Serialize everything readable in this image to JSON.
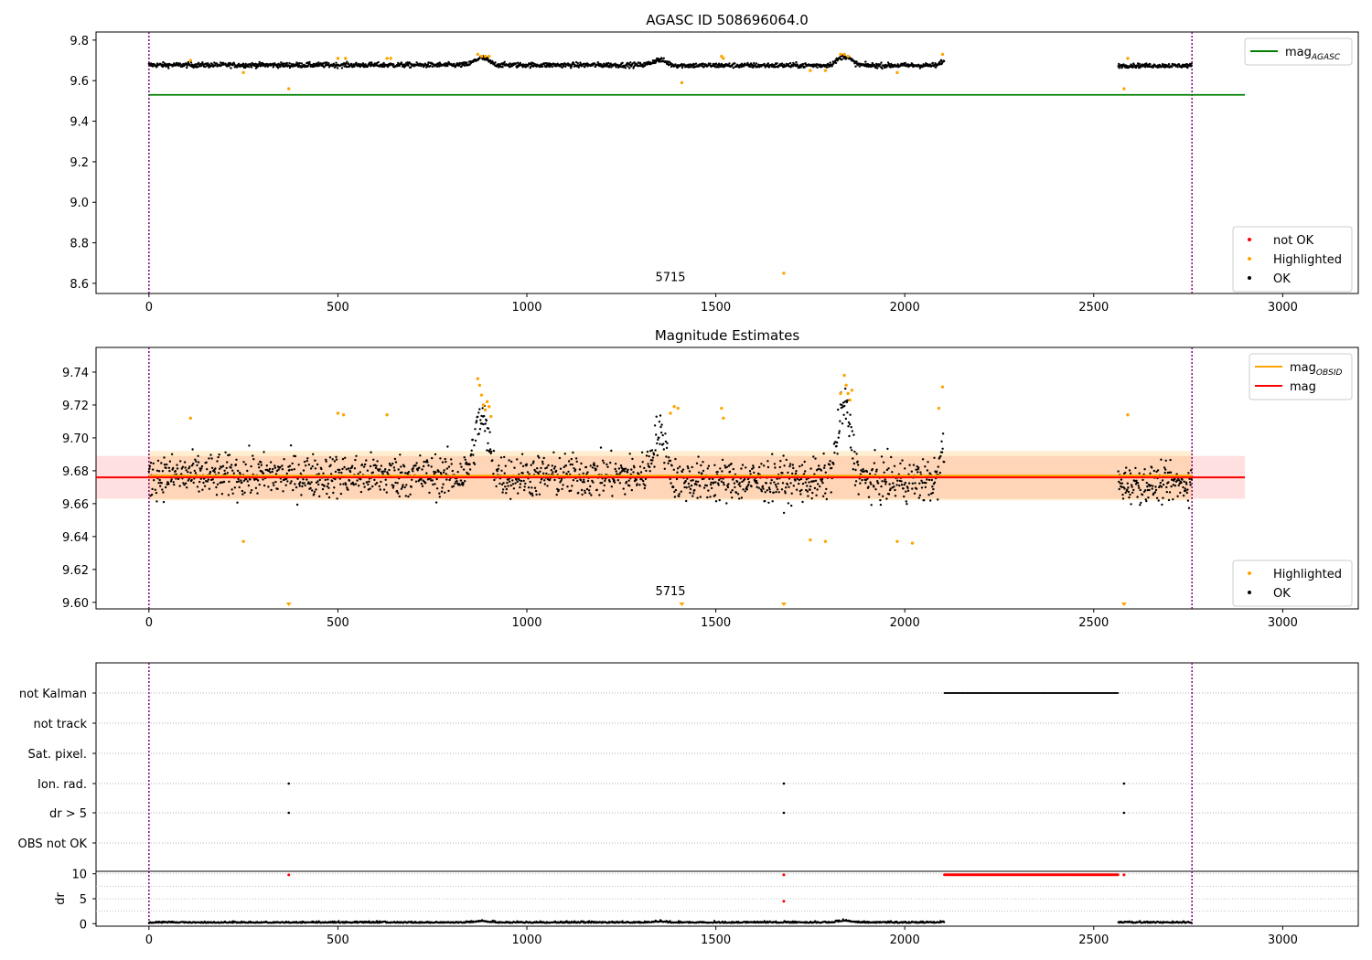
{
  "chart_data": [
    {
      "type": "scatter",
      "title": "AGASC ID 508696064.0",
      "xlabel": "",
      "ylabel": "",
      "xlim": [
        -140,
        3200
      ],
      "ylim": [
        8.55,
        9.84
      ],
      "x_ticks": [
        0,
        500,
        1000,
        1500,
        2000,
        2500,
        3000
      ],
      "y_ticks": [
        8.6,
        8.8,
        9.0,
        9.2,
        9.4,
        9.6,
        9.8
      ],
      "y_tick_labels": [
        "8.6",
        "8.8",
        "9.0",
        "9.2",
        "9.4",
        "9.6",
        "9.8"
      ],
      "vlines": [
        0,
        2760
      ],
      "obsid_label": {
        "text": "5715",
        "x": 1380,
        "y": 8.61
      },
      "mag_agasc": {
        "value": 9.53,
        "x_range": [
          0,
          2900
        ],
        "color": "#008000"
      },
      "segments": [
        {
          "x_range": [
            0,
            1380
          ],
          "base": 9.677,
          "spread": 0.012
        },
        {
          "x_range": [
            1380,
            2105
          ],
          "base": 9.675,
          "spread": 0.012
        },
        {
          "x_range": [
            2565,
            2760
          ],
          "base": 9.674,
          "spread": 0.01
        }
      ],
      "bumps": [
        {
          "center": 880,
          "width": 25,
          "height": 0.035
        },
        {
          "center": 1350,
          "width": 25,
          "height": 0.025
        },
        {
          "center": 1840,
          "width": 25,
          "height": 0.045
        },
        {
          "center": 2100,
          "width": 8,
          "height": 0.02
        }
      ],
      "highlighted_points": [
        [
          110,
          9.7
        ],
        [
          250,
          9.64
        ],
        [
          370,
          9.56
        ],
        [
          500,
          9.71
        ],
        [
          520,
          9.71
        ],
        [
          630,
          9.71
        ],
        [
          640,
          9.71
        ],
        [
          870,
          9.73
        ],
        [
          880,
          9.72
        ],
        [
          890,
          9.72
        ],
        [
          900,
          9.72
        ],
        [
          1410,
          9.59
        ],
        [
          1515,
          9.72
        ],
        [
          1520,
          9.71
        ],
        [
          1680,
          8.65
        ],
        [
          1750,
          9.65
        ],
        [
          1790,
          9.65
        ],
        [
          1830,
          9.73
        ],
        [
          1840,
          9.73
        ],
        [
          1850,
          9.72
        ],
        [
          1980,
          9.64
        ],
        [
          2100,
          9.73
        ],
        [
          2580,
          9.56
        ],
        [
          2590,
          9.71
        ]
      ],
      "legend_top": [
        {
          "label": "mag",
          "sub": "AGASC",
          "color": "#008000"
        }
      ],
      "legend_bottom": [
        {
          "label": "not OK",
          "color": "#ff0000"
        },
        {
          "label": "Highlighted",
          "color": "#ffa500"
        },
        {
          "label": "OK",
          "color": "#000000"
        }
      ]
    },
    {
      "type": "scatter",
      "title": "Magnitude Estimates",
      "xlabel": "",
      "ylabel": "",
      "xlim": [
        -140,
        3200
      ],
      "ylim": [
        9.596,
        9.755
      ],
      "x_ticks": [
        0,
        500,
        1000,
        1500,
        2000,
        2500,
        3000
      ],
      "y_ticks": [
        9.6,
        9.62,
        9.64,
        9.66,
        9.68,
        9.7,
        9.72,
        9.74
      ],
      "y_tick_labels": [
        "9.60",
        "9.62",
        "9.64",
        "9.66",
        "9.68",
        "9.70",
        "9.72",
        "9.74"
      ],
      "vlines": [
        0,
        2760
      ],
      "obsid_label": {
        "text": "5715",
        "x": 1380,
        "y": 9.6
      },
      "mag": {
        "value": 9.676,
        "band": [
          9.663,
          9.689
        ],
        "x_range": [
          -140,
          2900
        ],
        "color": "#ff0000"
      },
      "mag_obsid": {
        "value": 9.677,
        "band": [
          9.662,
          9.692
        ],
        "x_range": [
          0,
          2760
        ],
        "color": "#ffa500"
      },
      "segments": [
        {
          "x_range": [
            0,
            1380
          ],
          "base": 9.677,
          "spread": 0.013
        },
        {
          "x_range": [
            1380,
            2105
          ],
          "base": 9.674,
          "spread": 0.013
        },
        {
          "x_range": [
            2565,
            2760
          ],
          "base": 9.672,
          "spread": 0.011
        }
      ],
      "bumps": [
        {
          "center": 880,
          "width": 25,
          "height": 0.035
        },
        {
          "center": 1350,
          "width": 25,
          "height": 0.025
        },
        {
          "center": 1840,
          "width": 25,
          "height": 0.045
        },
        {
          "center": 2100,
          "width": 8,
          "height": 0.02
        }
      ],
      "highlighted_points": [
        [
          110,
          9.712
        ],
        [
          250,
          9.637
        ],
        [
          500,
          9.715
        ],
        [
          515,
          9.714
        ],
        [
          630,
          9.714
        ],
        [
          870,
          9.736
        ],
        [
          875,
          9.732
        ],
        [
          880,
          9.726
        ],
        [
          885,
          9.72
        ],
        [
          890,
          9.717
        ],
        [
          895,
          9.722
        ],
        [
          900,
          9.719
        ],
        [
          905,
          9.713
        ],
        [
          1380,
          9.715
        ],
        [
          1390,
          9.719
        ],
        [
          1400,
          9.718
        ],
        [
          1515,
          9.718
        ],
        [
          1520,
          9.712
        ],
        [
          1750,
          9.638
        ],
        [
          1790,
          9.637
        ],
        [
          1830,
          9.727
        ],
        [
          1840,
          9.738
        ],
        [
          1845,
          9.732
        ],
        [
          1850,
          9.727
        ],
        [
          1855,
          9.723
        ],
        [
          1860,
          9.729
        ],
        [
          1980,
          9.637
        ],
        [
          2020,
          9.636
        ],
        [
          2090,
          9.718
        ],
        [
          2100,
          9.731
        ],
        [
          2590,
          9.714
        ]
      ],
      "offscale_markers": [
        370,
        1410,
        1680,
        2580
      ],
      "legend_top": [
        {
          "label": "mag",
          "sub": "OBSID",
          "color": "#ffa500"
        },
        {
          "label": "mag",
          "sub": "",
          "color": "#ff0000"
        }
      ],
      "legend_bottom": [
        {
          "label": "Highlighted",
          "color": "#ffa500"
        },
        {
          "label": "OK",
          "color": "#000000"
        }
      ]
    },
    {
      "type": "scatter",
      "title": "",
      "xlabel": "",
      "ylabel": "dr",
      "xlim": [
        -140,
        3200
      ],
      "x_ticks": [
        0,
        500,
        1000,
        1500,
        2000,
        2500,
        3000
      ],
      "vlines": [
        0,
        2760
      ],
      "flag_rows": [
        "not Kalman",
        "not track",
        "Sat. pixel.",
        "Ion. rad.",
        "dr > 5",
        "OBS not OK"
      ],
      "flag_points": {
        "not Kalman": {
          "range": [
            2105,
            2565
          ]
        },
        "Ion. rad.": {
          "points": [
            370,
            1680,
            2580
          ]
        },
        "dr > 5": {
          "points": [
            370,
            1680,
            2580
          ]
        }
      },
      "dr_ylim": [
        -0.5,
        10.5
      ],
      "dr_ticks": [
        0,
        5,
        10
      ],
      "dr_tick_labels": [
        "0",
        "5",
        "10"
      ],
      "dr_red_range": [
        2105,
        2565
      ],
      "dr_red_points": [
        [
          370,
          9.8
        ],
        [
          1680,
          9.8
        ],
        [
          1680,
          4.5
        ],
        [
          2580,
          9.8
        ]
      ],
      "dr_black_segments": [
        [
          0,
          2105
        ],
        [
          2565,
          2760
        ]
      ]
    }
  ]
}
